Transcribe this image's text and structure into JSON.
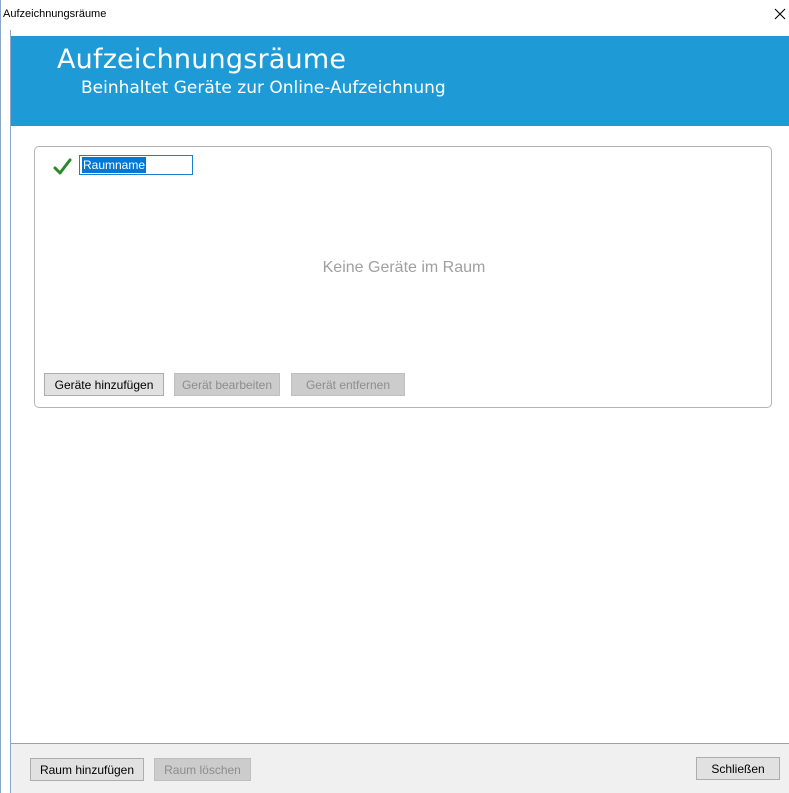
{
  "window": {
    "title": "Aufzeichnungsräume"
  },
  "banner": {
    "title": "Aufzeichnungsräume",
    "subtitle": "Beinhaltet Geräte zur Online-Aufzeichnung",
    "color": "#1e9bd6"
  },
  "room": {
    "name_value": "Raumname",
    "empty_text": "Keine Geräte im Raum",
    "buttons": {
      "add": "Geräte hinzufügen",
      "edit": "Gerät bearbeiten",
      "remove": "Gerät entfernen"
    }
  },
  "footer": {
    "add_room": "Raum hinzufügen",
    "delete_room": "Raum löschen",
    "close": "Schließen"
  },
  "icons": {
    "close": "close-icon",
    "check": "check-icon"
  }
}
